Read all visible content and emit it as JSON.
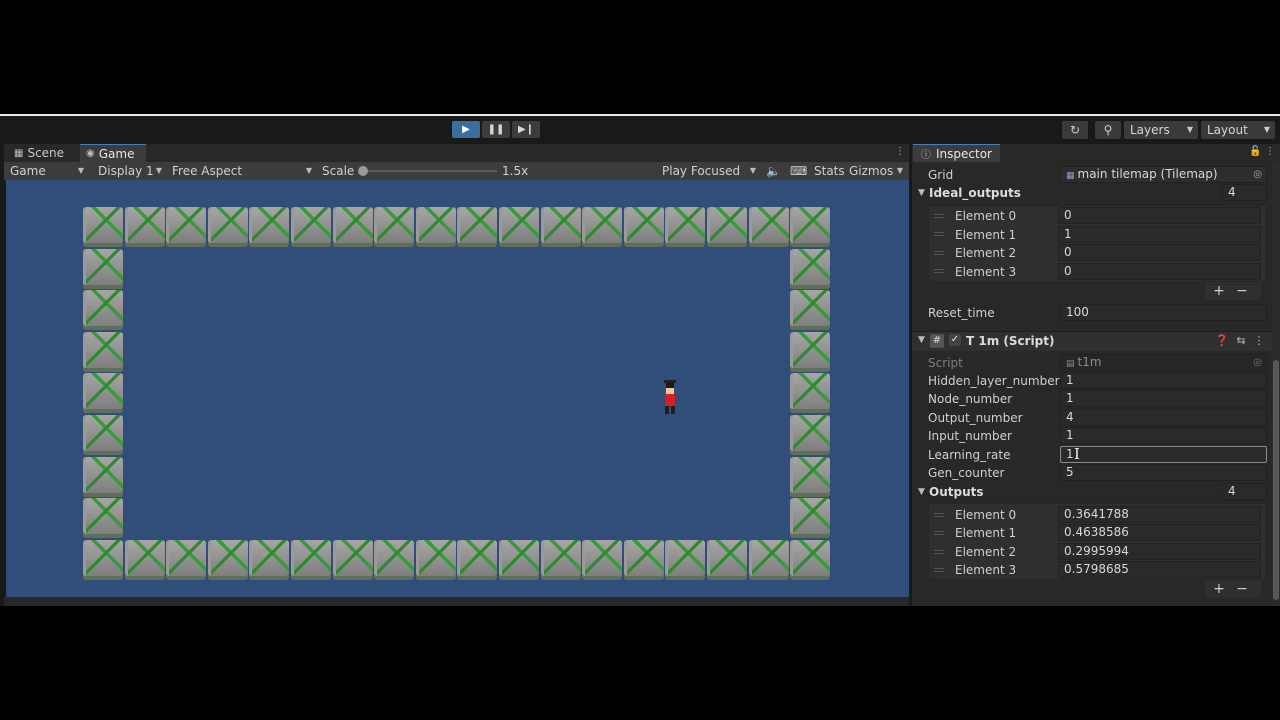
{
  "toolbar": {
    "play_icon": "play-icon",
    "pause_icon": "pause-icon",
    "step_icon": "step-icon",
    "history_icon": "history-icon",
    "search_icon": "search-icon",
    "layers_label": "Layers",
    "layout_label": "Layout"
  },
  "game_panel": {
    "tabs": [
      {
        "label": "Scene",
        "icon": "grid-icon"
      },
      {
        "label": "Game",
        "icon": "gamepad-icon"
      }
    ],
    "game_dropdown": "Game",
    "display_dropdown": "Display 1",
    "aspect_dropdown": "Free Aspect",
    "scale_label": "Scale",
    "scale_value": "1.5x",
    "scale_slider_fraction": 0.0,
    "play_mode_dropdown": "Play Focused",
    "stats_label": "Stats",
    "gizmos_label": "Gizmos",
    "background_color": "#314d79"
  },
  "inspector": {
    "tab_label": "Inspector",
    "grid_label": "Grid",
    "grid_value": "main tilemap (Tilemap)",
    "ideal_outputs": {
      "label": "Ideal_outputs",
      "count": "4",
      "elements": [
        {
          "label": "Element 0",
          "value": "0"
        },
        {
          "label": "Element 1",
          "value": "1"
        },
        {
          "label": "Element 2",
          "value": "0"
        },
        {
          "label": "Element 3",
          "value": "0"
        }
      ]
    },
    "reset_time_label": "Reset_time",
    "reset_time_value": "100",
    "component_title": "T 1m (Script)",
    "script_label": "Script",
    "script_value": "t1m",
    "fields": [
      {
        "label": "Hidden_layer_number",
        "value": "1"
      },
      {
        "label": "Node_number",
        "value": "1"
      },
      {
        "label": "Output_number",
        "value": "4"
      },
      {
        "label": "Input_number",
        "value": "1"
      },
      {
        "label": "Learning_rate",
        "value": "1"
      },
      {
        "label": "Gen_counter",
        "value": "5"
      }
    ],
    "outputs": {
      "label": "Outputs",
      "count": "4",
      "elements": [
        {
          "label": "Element 0",
          "value": "0.3641788"
        },
        {
          "label": "Element 1",
          "value": "0.4638586"
        },
        {
          "label": "Element 2",
          "value": "0.2995994"
        },
        {
          "label": "Element 3",
          "value": "0.5798685"
        }
      ]
    },
    "plus_label": "+",
    "minus_label": "−"
  }
}
